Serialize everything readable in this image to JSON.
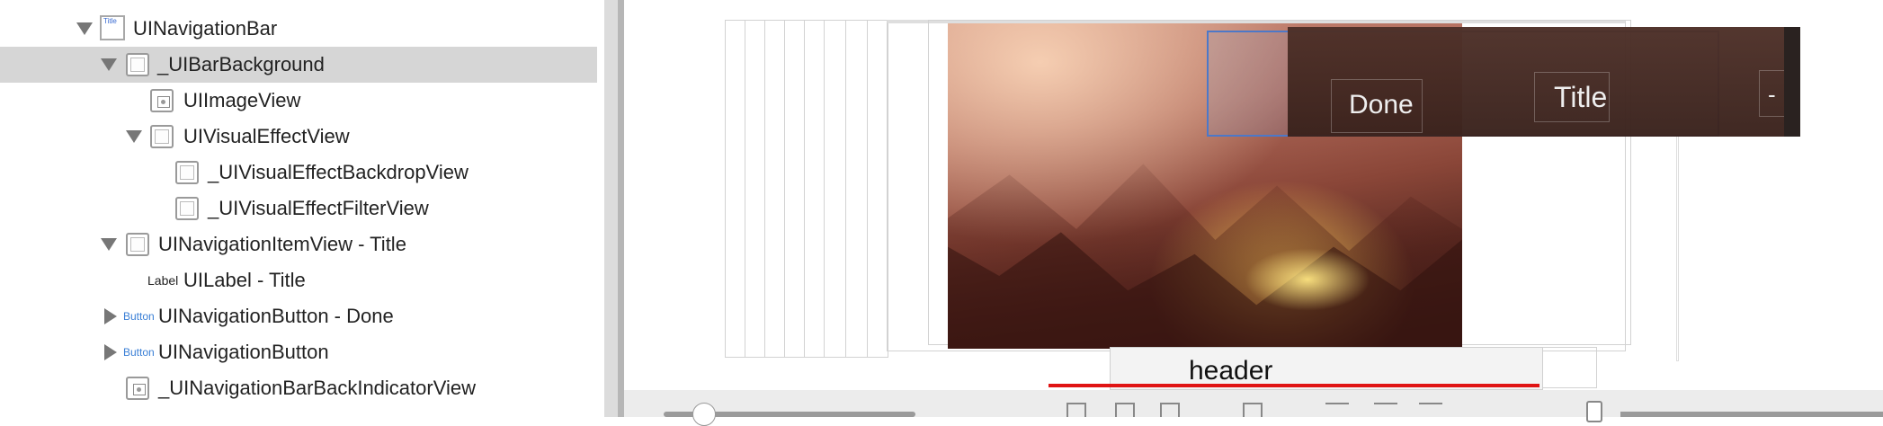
{
  "outline": {
    "items": [
      {
        "label": "UINavigationBar",
        "expanded": true,
        "icon": "navigation-bar-icon"
      },
      {
        "label": "_UIBarBackground",
        "expanded": true,
        "selected": true,
        "icon": "view-icon"
      },
      {
        "label": "UIImageView",
        "icon": "image-view-icon"
      },
      {
        "label": "UIVisualEffectView",
        "expanded": true,
        "icon": "view-icon"
      },
      {
        "label": "_UIVisualEffectBackdropView",
        "icon": "view-icon"
      },
      {
        "label": "_UIVisualEffectFilterView",
        "icon": "view-icon"
      },
      {
        "label": "UINavigationItemView - Title",
        "expanded": true,
        "icon": "view-icon"
      },
      {
        "label": "UILabel - Title",
        "icon": "label-icon",
        "icon_text": "Label"
      },
      {
        "label": "UINavigationButton - Done",
        "expanded": false,
        "icon": "button-icon",
        "icon_text": "Button"
      },
      {
        "label": "UINavigationButton",
        "expanded": false,
        "icon": "button-icon",
        "icon_text": "Button"
      },
      {
        "label": "_UINavigationBarBackIndicatorView",
        "icon": "image-view-icon"
      }
    ],
    "nav_icon_text": "Title"
  },
  "canvas": {
    "done_label": "Done",
    "title_label": "Title",
    "header_label": "header",
    "right_glyph": "-"
  },
  "colors": {
    "selection": "#d6d6d6",
    "outline_blue": "#4d78c8",
    "red_line": "#e01414"
  },
  "toolbar": {
    "zoom_slider_value": 0.16
  }
}
